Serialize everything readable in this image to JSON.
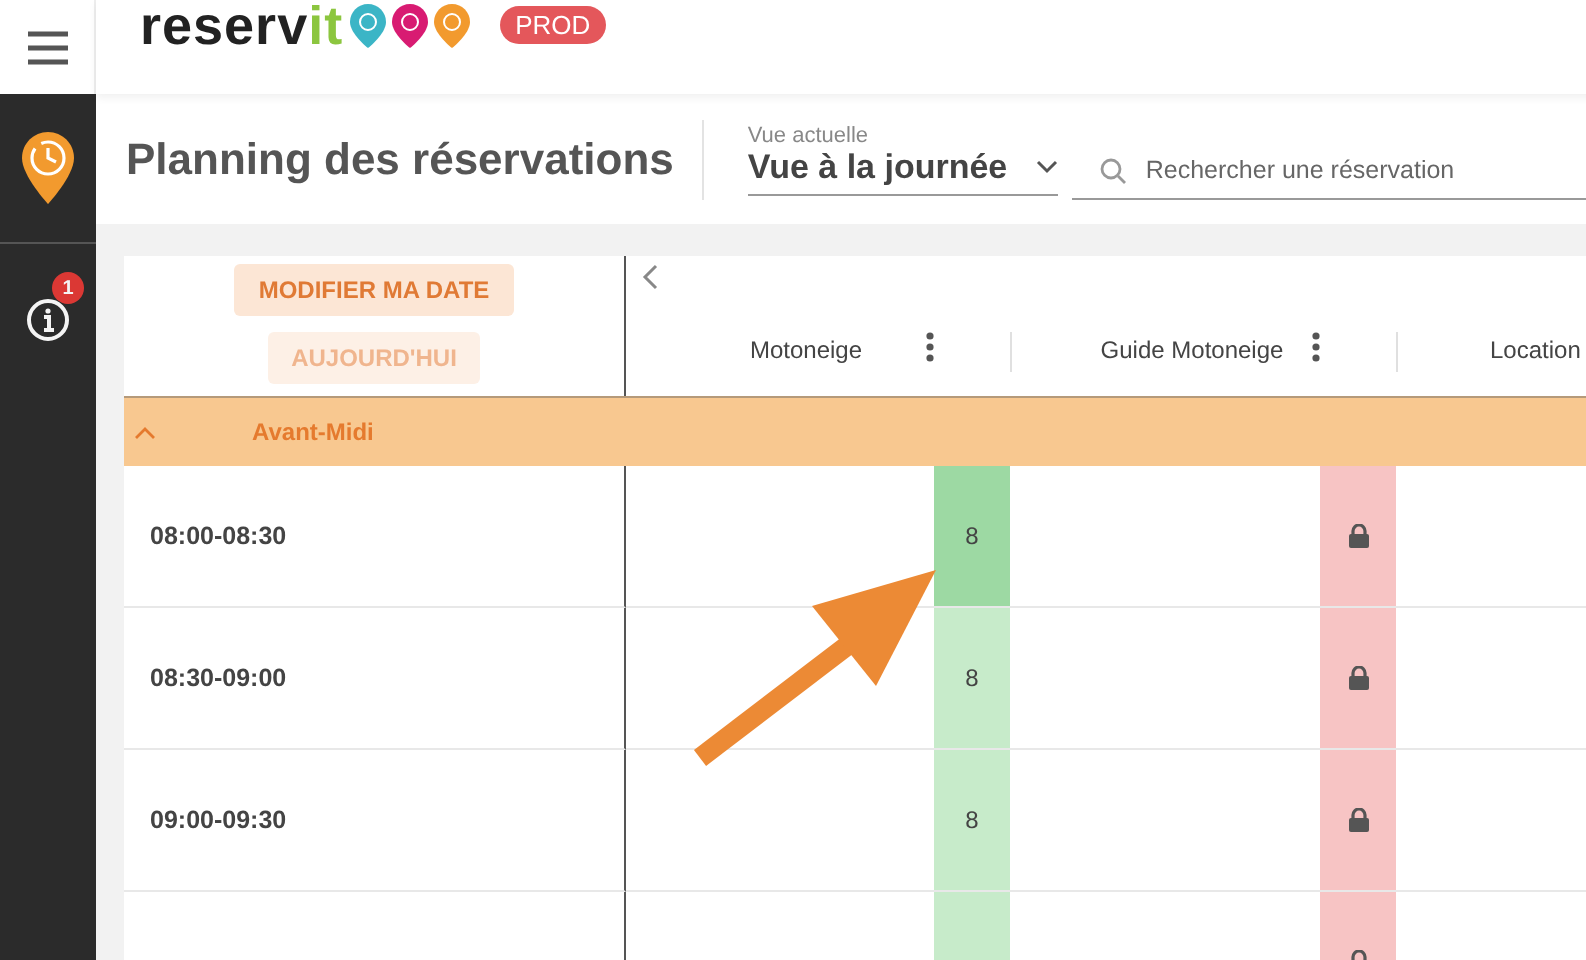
{
  "header": {
    "logo": {
      "text": "reserv",
      "accent": "it"
    },
    "environment": "PROD"
  },
  "sidebar": {
    "items": [
      {
        "kind": "planning",
        "selected": true
      },
      {
        "kind": "info",
        "selected": false,
        "badge": "1"
      }
    ]
  },
  "title_bar": {
    "title": "Planning des réservations",
    "view_select": {
      "label": "Vue actuelle",
      "value": "Vue à la journée"
    },
    "search": {
      "placeholder": "Rechercher une réservation"
    }
  },
  "planning": {
    "buttons": [
      {
        "label": "MODIFIER MA DATE",
        "disabled": false
      },
      {
        "label": "AUJOURD'HUI",
        "disabled": true
      }
    ],
    "columns": [
      {
        "label": "Motoneige"
      },
      {
        "label": "Guide Motoneige"
      },
      {
        "label": "Location"
      }
    ],
    "group": {
      "label": "Avant-Midi",
      "expanded": true
    },
    "rows": [
      {
        "time": "08:00-08:30",
        "cells": [
          {
            "kind": "count",
            "value": "8",
            "highlighted": true
          },
          {
            "kind": "locked"
          }
        ]
      },
      {
        "time": "08:30-09:00",
        "cells": [
          {
            "kind": "count",
            "value": "8",
            "highlighted": false
          },
          {
            "kind": "locked"
          }
        ]
      },
      {
        "time": "09:00-09:30",
        "cells": [
          {
            "kind": "count",
            "value": "8",
            "highlighted": false
          },
          {
            "kind": "locked"
          }
        ]
      },
      {
        "cells": [
          {
            "kind": "count",
            "highlighted": false
          },
          {
            "kind": "locked"
          }
        ]
      }
    ]
  }
}
